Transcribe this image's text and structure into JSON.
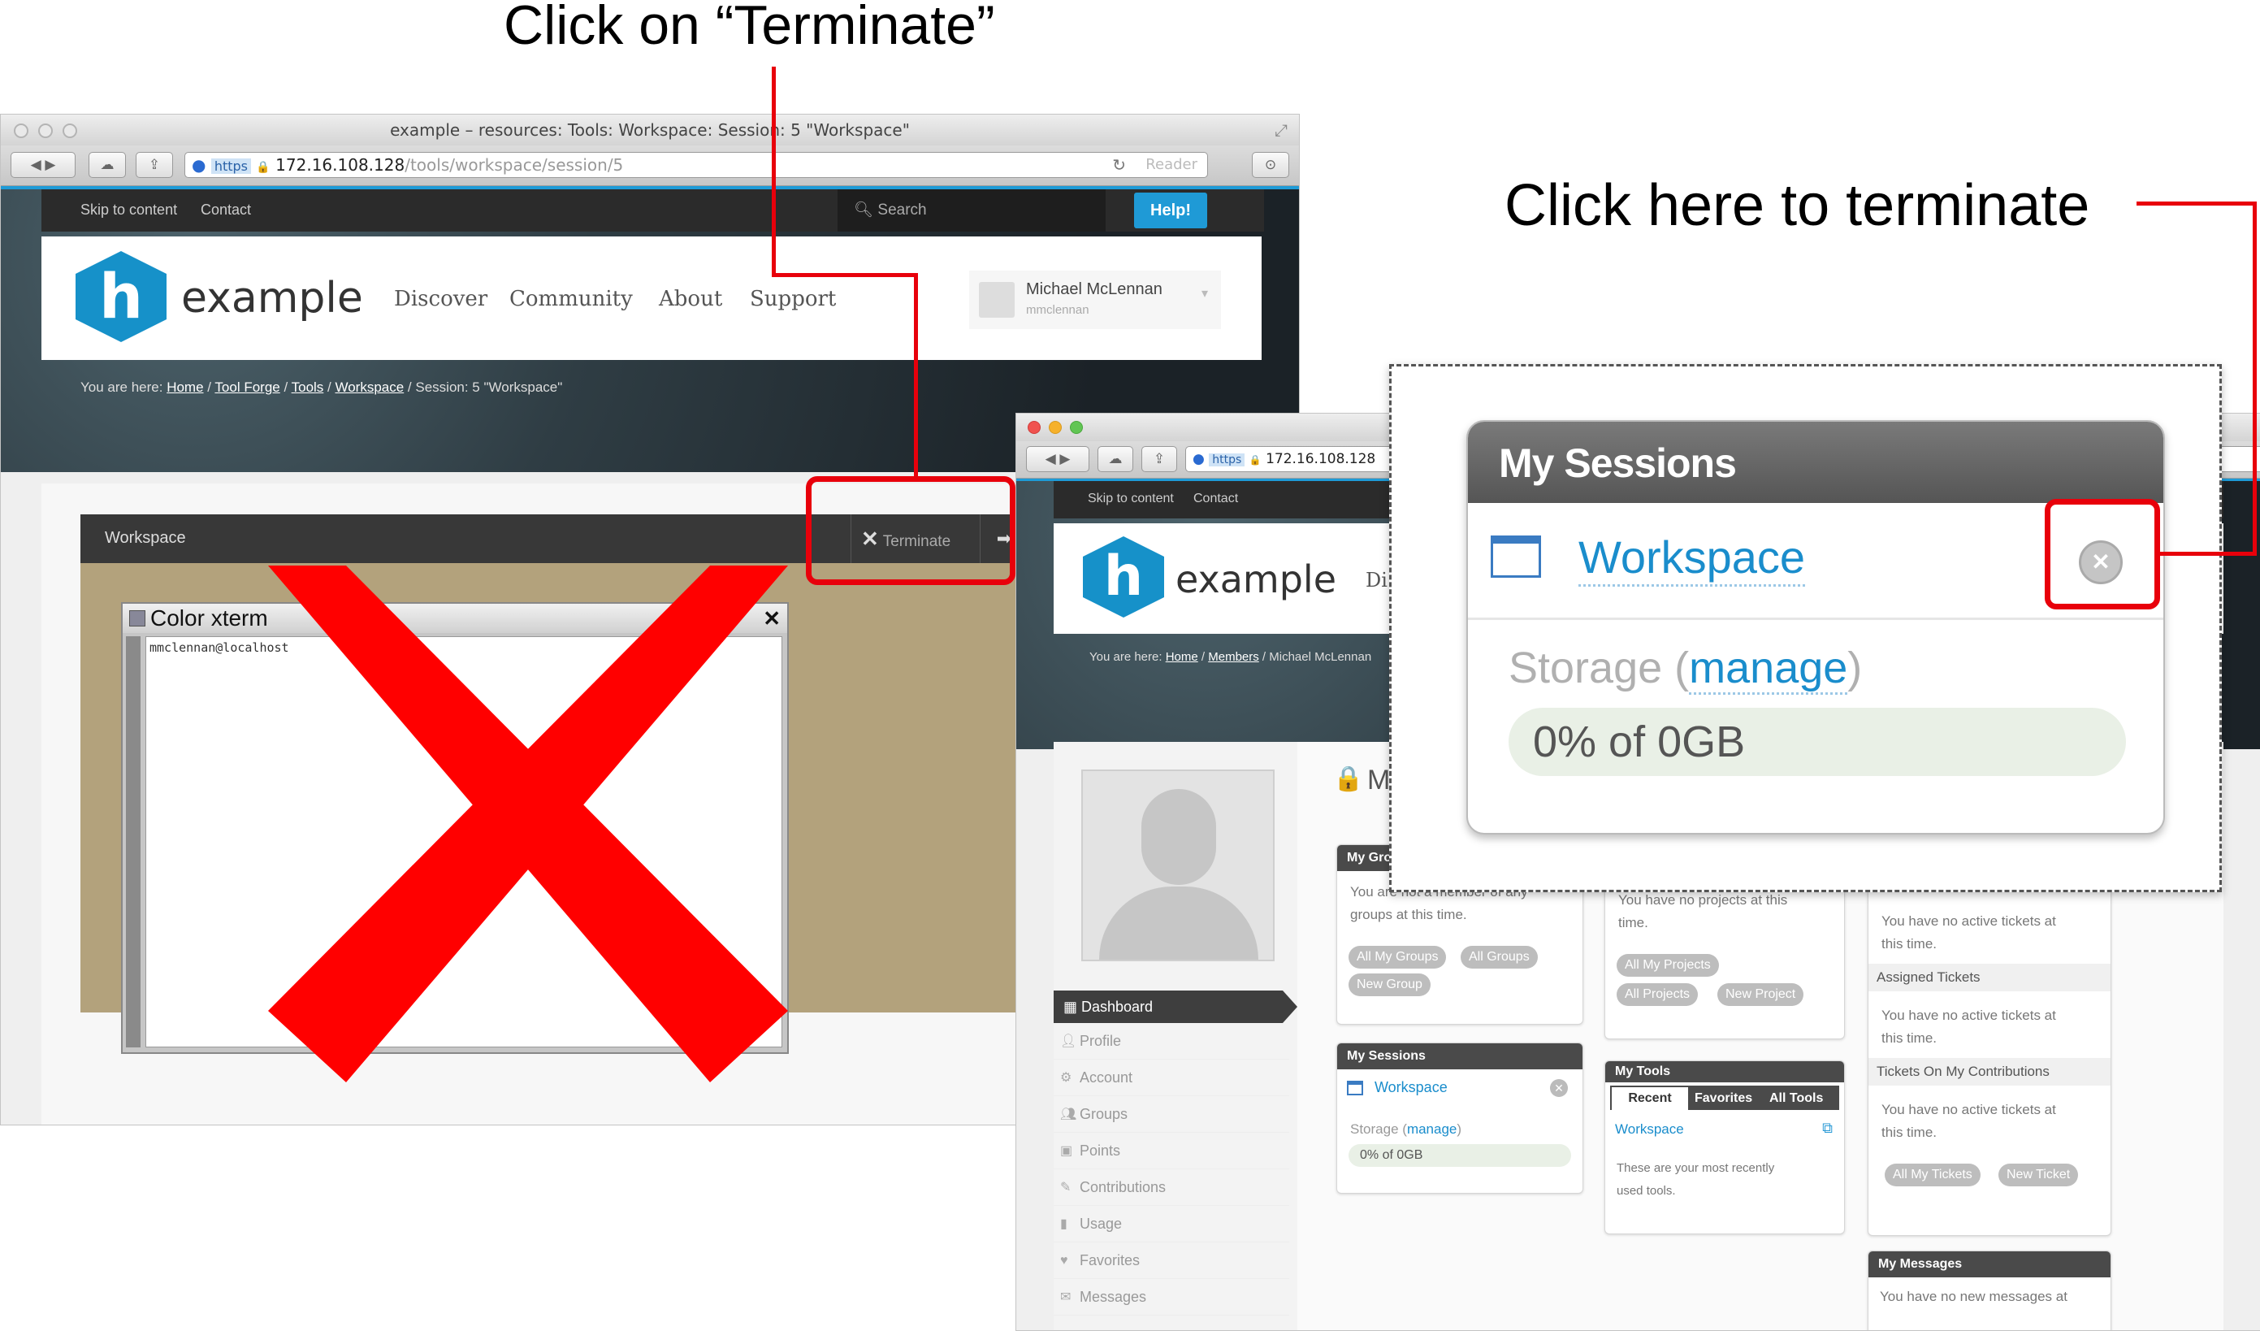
{
  "annotations": {
    "top_label": "Click on “Terminate”",
    "right_label": "Click here to terminate"
  },
  "window_a": {
    "title": "example – resources: Tools: Workspace: Session: 5 \"Workspace\"",
    "url_scheme": "https",
    "url_host": "172.16.108.128",
    "url_path": "/tools/workspace/session/5",
    "reader_label": "Reader",
    "skip_link": "Skip to content",
    "contact_link": "Contact",
    "search_placeholder": "Search",
    "help_label": "Help!",
    "logo_letter": "h",
    "logo_word": "example",
    "nav": [
      "Discover",
      "Community",
      "About",
      "Support"
    ],
    "user_name": "Michael McLennan",
    "user_login": "mmclennan",
    "breadcrumb_prefix": "You are here:",
    "breadcrumb": [
      "Home",
      "Tool Forge",
      "Tools",
      "Workspace"
    ],
    "breadcrumb_current": "Session: 5 \"Workspace\"",
    "session_title": "Workspace",
    "terminate_label": "Terminate",
    "xterm_title": "Color xterm",
    "xterm_prompt": "mmclennan@localhost"
  },
  "window_b": {
    "url_scheme": "https",
    "url_host": "172.16.108.128",
    "skip_link": "Skip to content",
    "contact_link": "Contact",
    "logo_letter": "h",
    "logo_word": "example",
    "nav_partial": "Di",
    "breadcrumb_prefix": "You are here:",
    "breadcrumb": [
      "Home",
      "Members"
    ],
    "breadcrumb_current": "Michael McLennan",
    "heading_partial": "M",
    "sidebar": [
      "Dashboard",
      "Profile",
      "Account",
      "Groups",
      "Points",
      "Contributions",
      "Usage",
      "Favorites",
      "Messages"
    ],
    "groups_module": {
      "title": "My Gro",
      "text": [
        "You are not a member of any",
        "groups at this time."
      ],
      "buttons": [
        "All My Groups",
        "All Groups",
        "New Group"
      ]
    },
    "projects_module": {
      "text": [
        "You have no projects at this",
        "time."
      ],
      "buttons": [
        "All My Projects",
        "All Projects",
        "New Project"
      ]
    },
    "tickets_module": {
      "line1": [
        "You have no active tickets at",
        "this time."
      ],
      "assigned": "Assigned Tickets",
      "line2": [
        "You have no active tickets at",
        "this time."
      ],
      "contrib": "Tickets On My Contributions",
      "line3": [
        "You have no active tickets at",
        "this time."
      ],
      "buttons": [
        "All My Tickets",
        "New Ticket"
      ]
    },
    "sessions_module": {
      "title": "My Sessions",
      "item": "Workspace",
      "storage_label": "Storage",
      "manage": "manage",
      "usage": "0% of 0GB"
    },
    "tools_module": {
      "title": "My Tools",
      "tabs": [
        "Recent",
        "Favorites",
        "All Tools"
      ],
      "item": "Workspace",
      "note": [
        "These are your most recently",
        "used tools."
      ]
    },
    "messages_module": {
      "title": "My Messages",
      "text": "You have no new messages at"
    }
  },
  "zoom": {
    "title": "My Sessions",
    "item": "Workspace",
    "storage_label": "Storage",
    "manage": "manage",
    "usage": "0% of 0GB"
  },
  "colors": {
    "annotation_red": "#e8000b",
    "link_blue": "#1a8dcc",
    "brand_blue": "#1691c9",
    "workspace_bg": "#b3a27c"
  }
}
